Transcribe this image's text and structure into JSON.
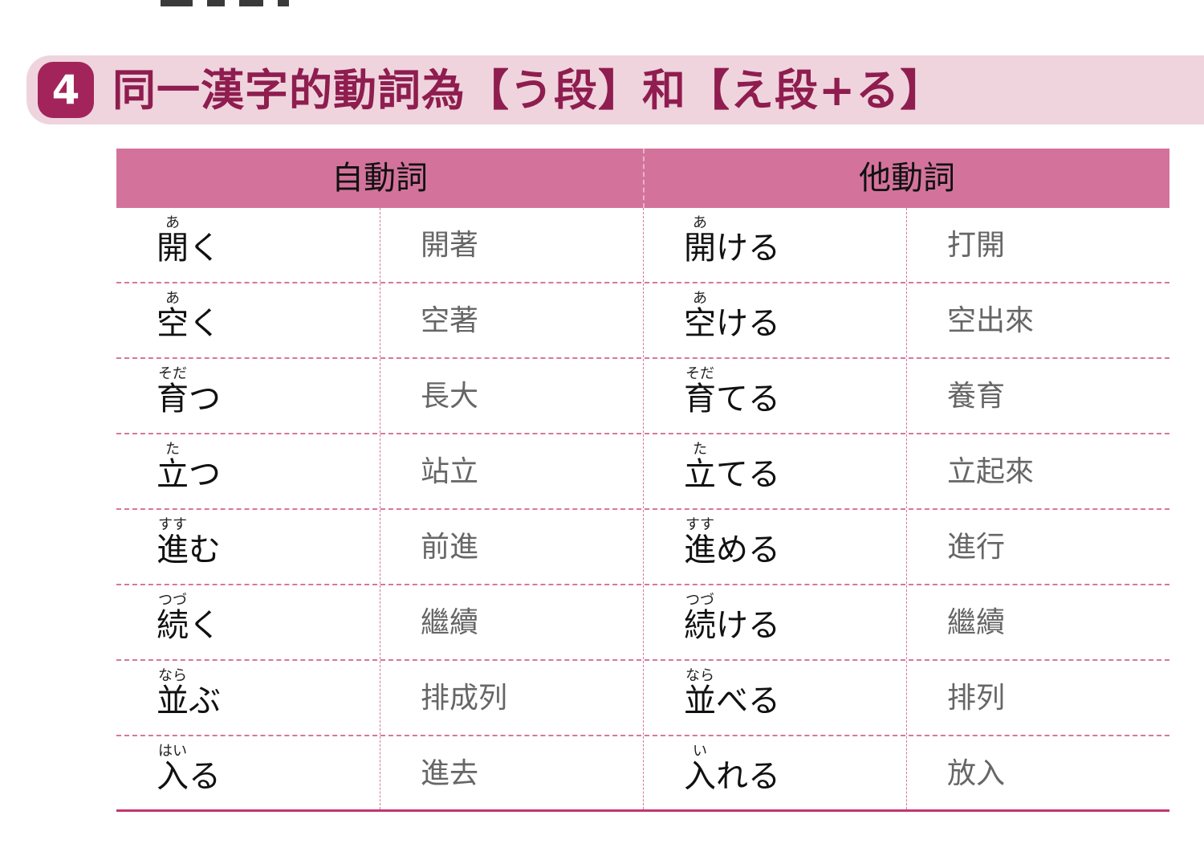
{
  "section": {
    "number": "4",
    "title": "同一漢字的動詞為【う段】和【え段+る】"
  },
  "table": {
    "headers": [
      "自動詞",
      "他動詞"
    ],
    "rows": [
      {
        "intransitive": {
          "kanji": "開",
          "reading": "あ",
          "okurigana": "く",
          "meaning": "開著"
        },
        "transitive": {
          "kanji": "開",
          "reading": "あ",
          "okurigana": "ける",
          "meaning": "打開"
        }
      },
      {
        "intransitive": {
          "kanji": "空",
          "reading": "あ",
          "okurigana": "く",
          "meaning": "空著"
        },
        "transitive": {
          "kanji": "空",
          "reading": "あ",
          "okurigana": "ける",
          "meaning": "空出來"
        }
      },
      {
        "intransitive": {
          "kanji": "育",
          "reading": "そだ",
          "okurigana": "つ",
          "meaning": "長大"
        },
        "transitive": {
          "kanji": "育",
          "reading": "そだ",
          "okurigana": "てる",
          "meaning": "養育"
        }
      },
      {
        "intransitive": {
          "kanji": "立",
          "reading": "た",
          "okurigana": "つ",
          "meaning": "站立"
        },
        "transitive": {
          "kanji": "立",
          "reading": "た",
          "okurigana": "てる",
          "meaning": "立起來"
        }
      },
      {
        "intransitive": {
          "kanji": "進",
          "reading": "すす",
          "okurigana": "む",
          "meaning": "前進"
        },
        "transitive": {
          "kanji": "進",
          "reading": "すす",
          "okurigana": "める",
          "meaning": "進行"
        }
      },
      {
        "intransitive": {
          "kanji": "続",
          "reading": "つづ",
          "okurigana": "く",
          "meaning": "繼續"
        },
        "transitive": {
          "kanji": "続",
          "reading": "つづ",
          "okurigana": "ける",
          "meaning": "繼續"
        }
      },
      {
        "intransitive": {
          "kanji": "並",
          "reading": "なら",
          "okurigana": "ぶ",
          "meaning": "排成列"
        },
        "transitive": {
          "kanji": "並",
          "reading": "なら",
          "okurigana": "べる",
          "meaning": "排列"
        }
      },
      {
        "intransitive": {
          "kanji": "入",
          "reading": "はい",
          "okurigana": "る",
          "meaning": "進去"
        },
        "transitive": {
          "kanji": "入",
          "reading": "い",
          "okurigana": "れる",
          "meaning": "放入"
        }
      }
    ]
  }
}
